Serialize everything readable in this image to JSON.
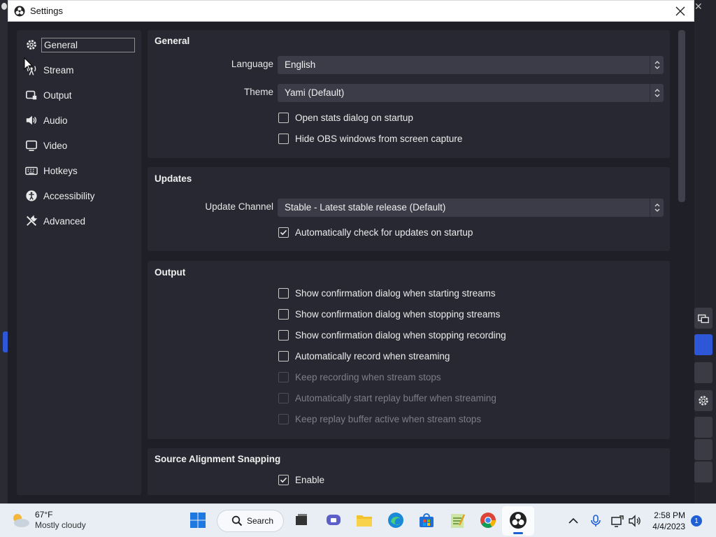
{
  "window": {
    "title": "Settings"
  },
  "sidebar": {
    "items": [
      {
        "label": "General",
        "icon": "gear-icon",
        "active": true
      },
      {
        "label": "Stream",
        "icon": "broadcast-icon"
      },
      {
        "label": "Output",
        "icon": "output-icon"
      },
      {
        "label": "Audio",
        "icon": "speaker-icon"
      },
      {
        "label": "Video",
        "icon": "monitor-icon"
      },
      {
        "label": "Hotkeys",
        "icon": "keyboard-icon"
      },
      {
        "label": "Accessibility",
        "icon": "accessibility-icon"
      },
      {
        "label": "Advanced",
        "icon": "tools-icon"
      }
    ]
  },
  "general": {
    "title": "General",
    "language_label": "Language",
    "language_value": "English",
    "theme_label": "Theme",
    "theme_value": "Yami (Default)",
    "open_stats": "Open stats dialog on startup",
    "hide_obs": "Hide OBS windows from screen capture"
  },
  "updates": {
    "title": "Updates",
    "channel_label": "Update Channel",
    "channel_value": "Stable - Latest stable release (Default)",
    "auto_check": "Automatically check for updates on startup"
  },
  "output": {
    "title": "Output",
    "confirm_start": "Show confirmation dialog when starting streams",
    "confirm_stop": "Show confirmation dialog when stopping streams",
    "confirm_stop_rec": "Show confirmation dialog when stopping recording",
    "auto_record": "Automatically record when streaming",
    "keep_recording": "Keep recording when stream stops",
    "auto_replay": "Automatically start replay buffer when streaming",
    "keep_replay": "Keep replay buffer active when stream stops"
  },
  "snapping": {
    "title": "Source Alignment Snapping",
    "enable": "Enable"
  },
  "taskbar": {
    "temp": "67°F",
    "weather": "Mostly cloudy",
    "search": "Search",
    "time": "2:58 PM",
    "date": "4/4/2023",
    "notifications": "1"
  },
  "colors": {
    "accent": "#1e5fd6",
    "panel": "#272831",
    "window_bg": "#1f2027",
    "select_bg": "#3b3c47"
  }
}
